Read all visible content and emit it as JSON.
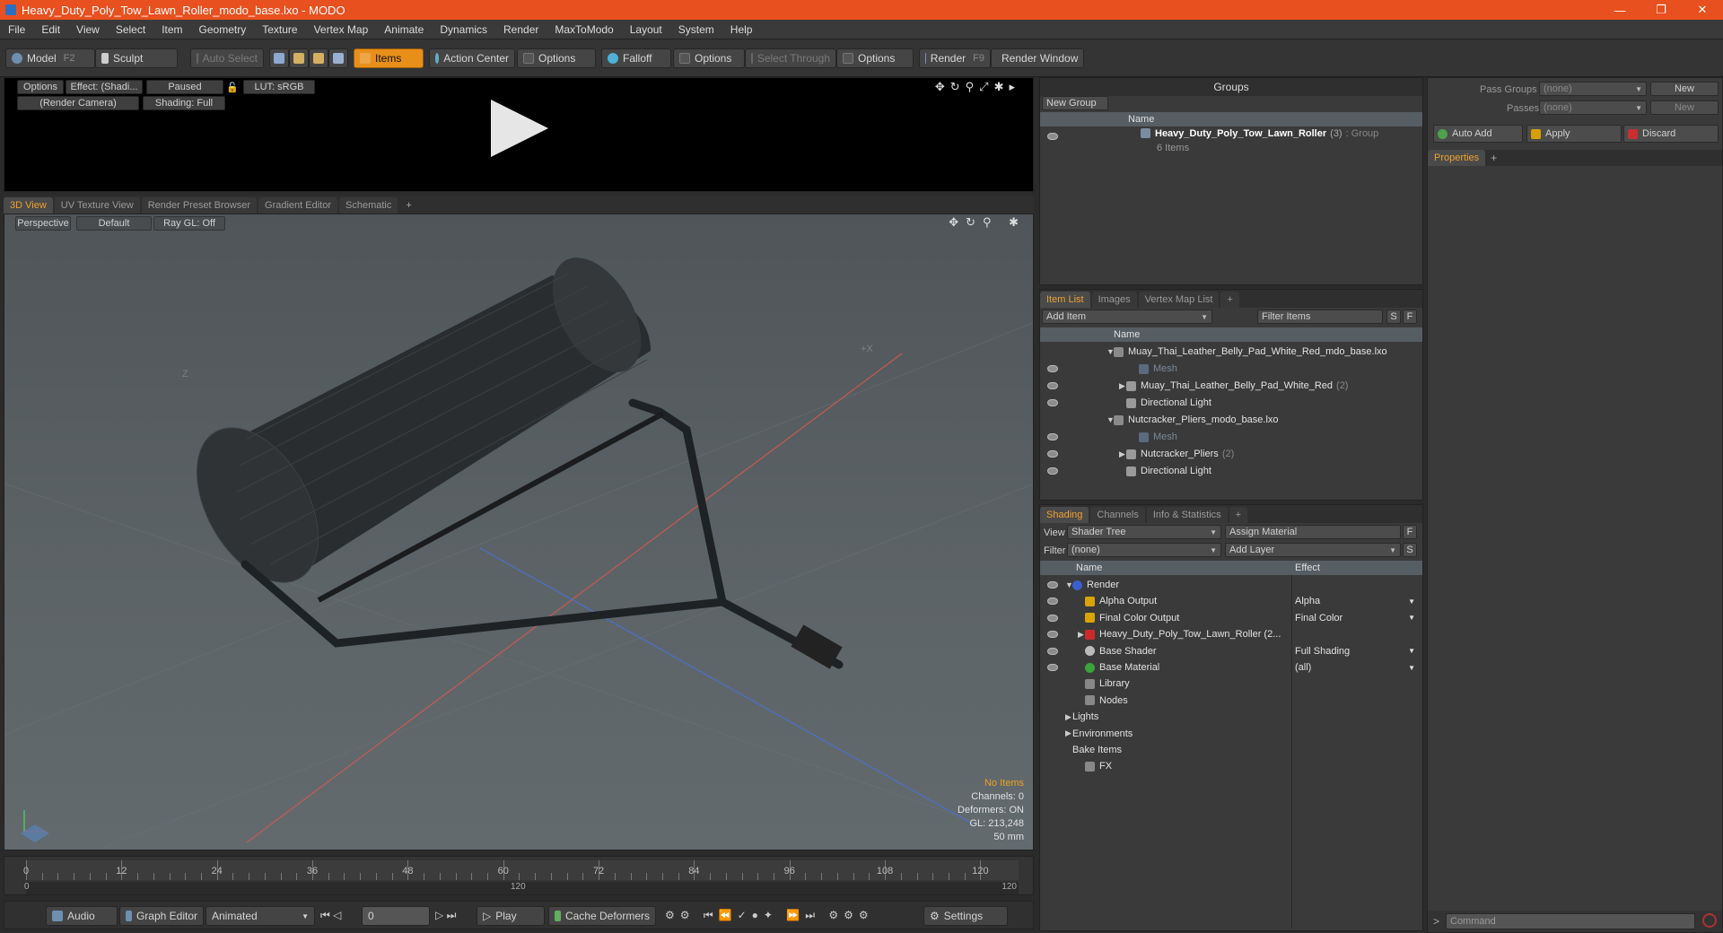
{
  "window": {
    "title": "Heavy_Duty_Poly_Tow_Lawn_Roller_modo_base.lxo - MODO",
    "controls": [
      "—",
      "❐",
      "✕"
    ]
  },
  "menu": [
    "File",
    "Edit",
    "View",
    "Select",
    "Item",
    "Geometry",
    "Texture",
    "Vertex Map",
    "Animate",
    "Dynamics",
    "Render",
    "MaxToModo",
    "Layout",
    "System",
    "Help"
  ],
  "toolbar": {
    "model": "Model",
    "model_key": "F2",
    "sculpt": "Sculpt",
    "auto_select": "Auto Select",
    "items": "Items",
    "action_center": "Action Center",
    "options1": "Options",
    "falloff": "Falloff",
    "options2": "Options",
    "select_through": "Select Through",
    "options3": "Options",
    "render": "Render",
    "render_key": "F9",
    "render_window": "Render Window"
  },
  "preview": {
    "options": "Options",
    "effect": "Effect: (Shadi...",
    "paused": "Paused",
    "lut": "LUT: sRGB",
    "camera": "(Render Camera)",
    "shading": "Shading: Full"
  },
  "viewport_tabs": [
    "3D View",
    "UV Texture View",
    "Render Preset Browser",
    "Gradient Editor",
    "Schematic",
    "+"
  ],
  "viewport": {
    "perspective": "Perspective",
    "default": "Default",
    "raygl": "Ray GL: Off",
    "axis_z": "Z",
    "axis_x": "+X",
    "info": {
      "items": "No Items",
      "channels": "Channels: 0",
      "deformers": "Deformers: ON",
      "gl": "GL: 213,248",
      "focal": "50 mm"
    }
  },
  "timeline": {
    "ticks": [
      "0",
      "12",
      "24",
      "36",
      "48",
      "60",
      "72",
      "84",
      "96",
      "108",
      "120"
    ],
    "start": "0",
    "mid": "120",
    "end": "120"
  },
  "bottombar": {
    "audio": "Audio",
    "graph_editor": "Graph Editor",
    "animated": "Animated",
    "frame": "0",
    "play": "Play",
    "cache": "Cache Deformers",
    "settings": "Settings"
  },
  "groups": {
    "title": "Groups",
    "new_group": "New Group",
    "col_name": "Name",
    "item": {
      "name": "Heavy_Duty_Poly_Tow_Lawn_Roller",
      "count": "(3)",
      "type": ": Group",
      "sub": "6 Items"
    }
  },
  "itemlist": {
    "tabs": [
      "Item List",
      "Images",
      "Vertex Map List",
      "+"
    ],
    "add_item": "Add Item",
    "filter": "Filter Items",
    "s": "S",
    "f": "F",
    "col_name": "Name",
    "rows": [
      {
        "label": "Muay_Thai_Leather_Belly_Pad_White_Red_mdo_base.lxo",
        "indent": 0,
        "tri": "▼",
        "dim": false,
        "count": ""
      },
      {
        "label": "Mesh",
        "indent": 2,
        "tri": "",
        "dim": true,
        "count": ""
      },
      {
        "label": "Muay_Thai_Leather_Belly_Pad_White_Red",
        "indent": 1,
        "tri": "▶",
        "dim": false,
        "count": "(2)"
      },
      {
        "label": "Directional Light",
        "indent": 1,
        "tri": "",
        "dim": false,
        "count": ""
      },
      {
        "label": "Nutcracker_Pliers_modo_base.lxo",
        "indent": 0,
        "tri": "▼",
        "dim": false,
        "count": ""
      },
      {
        "label": "Mesh",
        "indent": 2,
        "tri": "",
        "dim": true,
        "count": ""
      },
      {
        "label": "Nutcracker_Pliers",
        "indent": 1,
        "tri": "▶",
        "dim": false,
        "count": "(2)"
      },
      {
        "label": "Directional Light",
        "indent": 1,
        "tri": "",
        "dim": false,
        "count": ""
      }
    ]
  },
  "shading": {
    "tabs": [
      "Shading",
      "Channels",
      "Info & Statistics",
      "+"
    ],
    "view_lbl": "View",
    "view_val": "Shader Tree",
    "assign": "Assign Material",
    "filter_lbl": "Filter",
    "filter_val": "(none)",
    "add_layer": "Add Layer",
    "f": "F",
    "s": "S",
    "col_name": "Name",
    "col_effect": "Effect",
    "rows": [
      {
        "label": "Render",
        "effect": "",
        "indent": 0,
        "tri": "▼",
        "color": "#3a5fcf",
        "eye": true
      },
      {
        "label": "Alpha Output",
        "effect": "Alpha",
        "indent": 1,
        "tri": "",
        "color": "#d9a400",
        "eye": true
      },
      {
        "label": "Final Color Output",
        "effect": "Final Color",
        "indent": 1,
        "tri": "",
        "color": "#d9a400",
        "eye": true
      },
      {
        "label": "Heavy_Duty_Poly_Tow_Lawn_Roller (2...",
        "effect": "",
        "indent": 1,
        "tri": "▶",
        "color": "#cc2a2a",
        "eye": true
      },
      {
        "label": "Base Shader",
        "effect": "Full Shading",
        "indent": 1,
        "tri": "",
        "color": "#bbbbbb",
        "eye": true
      },
      {
        "label": "Base Material",
        "effect": "(all)",
        "indent": 1,
        "tri": "",
        "color": "#3ba33b",
        "eye": true
      },
      {
        "label": "Library",
        "effect": "",
        "indent": 1,
        "tri": "",
        "color": "#888",
        "eye": false
      },
      {
        "label": "Nodes",
        "effect": "",
        "indent": 1,
        "tri": "",
        "color": "#888",
        "eye": false
      },
      {
        "label": "Lights",
        "effect": "",
        "indent": 0,
        "tri": "▶",
        "color": "",
        "eye": false
      },
      {
        "label": "Environments",
        "effect": "",
        "indent": 0,
        "tri": "▶",
        "color": "",
        "eye": false
      },
      {
        "label": "Bake Items",
        "effect": "",
        "indent": 0,
        "tri": "",
        "color": "",
        "eye": false
      },
      {
        "label": "FX",
        "effect": "",
        "indent": 1,
        "tri": "",
        "color": "#888",
        "eye": false
      }
    ]
  },
  "props": {
    "pass_groups": "Pass Groups",
    "passes": "Passes",
    "none1": "(none)",
    "none2": "(none)",
    "new1": "New",
    "new2": "New",
    "auto_add": "Auto Add",
    "apply": "Apply",
    "discard": "Discard",
    "tab": "Properties",
    "plus": "+",
    "command": "Command"
  }
}
